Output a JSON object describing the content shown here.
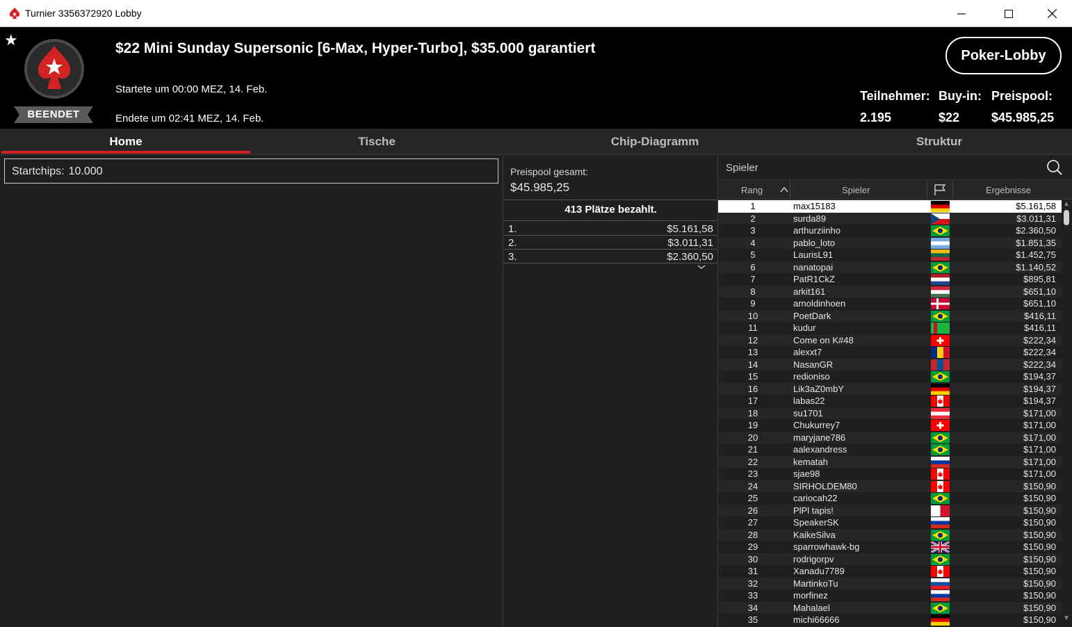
{
  "window": {
    "title": "Turnier 3356372920 Lobby"
  },
  "colors": {
    "accent": "#d32222",
    "background": "#1f1f1f",
    "header": "#000000"
  },
  "header": {
    "status": "BEENDET",
    "title": "$22 Mini Sunday Supersonic [6-Max, Hyper-Turbo], $35.000 garantiert",
    "started": "Startete um 00:00 MEZ, 14. Feb.",
    "ended": "Endete um 02:41 MEZ, 14. Feb.",
    "lobby_button": "Poker-Lobby",
    "stats": {
      "participants_label": "Teilnehmer:",
      "participants_value": "2.195",
      "buyin_label": "Buy-in:",
      "buyin_value": "$22",
      "prizepool_label": "Preispool:",
      "prizepool_value": "$45.985,25"
    }
  },
  "tabs": [
    "Home",
    "Tische",
    "Chip-Diagramm",
    "Struktur"
  ],
  "home": {
    "startchips_label": "Startchips:",
    "startchips_value": "10.000"
  },
  "prize": {
    "total_label": "Preispool gesamt:",
    "total_value": "$45.985,25",
    "paid_places": "413 Plätze bezahlt.",
    "payouts": [
      {
        "place": "1.",
        "amount": "$5.161,58"
      },
      {
        "place": "2.",
        "amount": "$3.011,31"
      },
      {
        "place": "3.",
        "amount": "$2.360,50"
      }
    ]
  },
  "players": {
    "search_label": "Spieler",
    "columns": {
      "rank": "Rang",
      "player": "Spieler",
      "results": "Ergebnisse"
    },
    "rows": [
      {
        "rank": "1",
        "name": "max15183",
        "flag": "de",
        "result": "$5.161,58"
      },
      {
        "rank": "2",
        "name": "surda89",
        "flag": "cz",
        "result": "$3.011,31"
      },
      {
        "rank": "3",
        "name": "arthurziinho",
        "flag": "br",
        "result": "$2.360,50"
      },
      {
        "rank": "4",
        "name": "pablo_loto",
        "flag": "ar",
        "result": "$1.851,35"
      },
      {
        "rank": "5",
        "name": "LaurisL91",
        "flag": "lt",
        "result": "$1.452,75"
      },
      {
        "rank": "6",
        "name": "nanatopai",
        "flag": "br",
        "result": "$1.140,52"
      },
      {
        "rank": "7",
        "name": "PatR1CkZ",
        "flag": "nl",
        "result": "$895,81"
      },
      {
        "rank": "8",
        "name": "arkit161",
        "flag": "hu",
        "result": "$651,10"
      },
      {
        "rank": "9",
        "name": "arnoldinhoen",
        "flag": "dk",
        "result": "$651,10"
      },
      {
        "rank": "10",
        "name": "PoetDark",
        "flag": "br",
        "result": "$416,11"
      },
      {
        "rank": "11",
        "name": "kudur",
        "flag": "tm",
        "result": "$416,11"
      },
      {
        "rank": "12",
        "name": "Come on K#48",
        "flag": "ch",
        "result": "$222,34"
      },
      {
        "rank": "13",
        "name": "alexxt7",
        "flag": "ro",
        "result": "$222,34"
      },
      {
        "rank": "14",
        "name": "NasanGR",
        "flag": "mn",
        "result": "$222,34"
      },
      {
        "rank": "15",
        "name": "redioniso",
        "flag": "br",
        "result": "$194,37"
      },
      {
        "rank": "16",
        "name": "Lik3aZ0mbY",
        "flag": "de",
        "result": "$194,37"
      },
      {
        "rank": "17",
        "name": "labas22",
        "flag": "ca",
        "result": "$194,37"
      },
      {
        "rank": "18",
        "name": "su1701",
        "flag": "at",
        "result": "$171,00"
      },
      {
        "rank": "19",
        "name": "Chukurrey7",
        "flag": "ch",
        "result": "$171,00"
      },
      {
        "rank": "20",
        "name": "maryjane786",
        "flag": "br",
        "result": "$171,00"
      },
      {
        "rank": "21",
        "name": "aalexandress",
        "flag": "br",
        "result": "$171,00"
      },
      {
        "rank": "22",
        "name": "kematah",
        "flag": "ru",
        "result": "$171,00"
      },
      {
        "rank": "23",
        "name": "sjae98",
        "flag": "ca",
        "result": "$171,00"
      },
      {
        "rank": "24",
        "name": "SIRHOLDEM80",
        "flag": "ca",
        "result": "$150,90"
      },
      {
        "rank": "25",
        "name": "cariocah22",
        "flag": "br",
        "result": "$150,90"
      },
      {
        "rank": "26",
        "name": "PlPl tapis!",
        "flag": "mt",
        "result": "$150,90"
      },
      {
        "rank": "27",
        "name": "SpeakerSK",
        "flag": "ru",
        "result": "$150,90"
      },
      {
        "rank": "28",
        "name": "KaikeSilva",
        "flag": "br",
        "result": "$150,90"
      },
      {
        "rank": "29",
        "name": "sparrowhawk-bg",
        "flag": "gb",
        "result": "$150,90"
      },
      {
        "rank": "30",
        "name": "rodrigorpv",
        "flag": "br",
        "result": "$150,90"
      },
      {
        "rank": "31",
        "name": "Xanadu7789",
        "flag": "ca",
        "result": "$150,90"
      },
      {
        "rank": "32",
        "name": "MartinkoTu",
        "flag": "sk",
        "result": "$150,90"
      },
      {
        "rank": "33",
        "name": "morfinez",
        "flag": "ru",
        "result": "$150,90"
      },
      {
        "rank": "34",
        "name": "Mahalael",
        "flag": "br",
        "result": "$150,90"
      },
      {
        "rank": "35",
        "name": "michi66666",
        "flag": "de",
        "result": "$150,90"
      }
    ]
  }
}
